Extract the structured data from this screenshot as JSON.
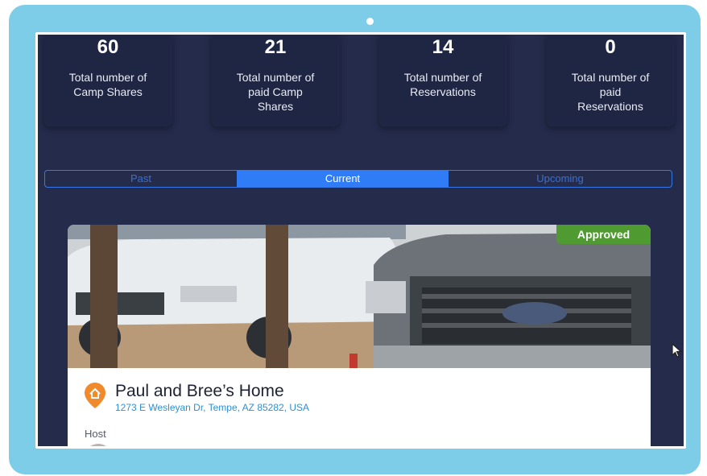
{
  "stats": [
    {
      "value": "60",
      "label": "Total number of Camp Shares"
    },
    {
      "value": "21",
      "label": "Total number of paid Camp Shares"
    },
    {
      "value": "14",
      "label": "Total number of Reservations"
    },
    {
      "value": "0",
      "label": "Total number of paid Reservations"
    }
  ],
  "tabs": [
    "Past",
    "Current",
    "Upcoming"
  ],
  "active_tab": "Current",
  "listing": {
    "status": "Approved",
    "title": "Paul and Bree’s Home",
    "address": "1273 E Wesleyan Dr, Tempe, AZ 85282, USA",
    "host_label": "Host"
  },
  "colors": {
    "frame": "#7ecde8",
    "app_background": "#242b4b",
    "accent": "#2f7cf6",
    "approved": "#4f9a31",
    "pin": "#f08a2a"
  },
  "icons": {
    "pin": "map-pin-icon",
    "cursor": "mouse-pointer-icon"
  }
}
